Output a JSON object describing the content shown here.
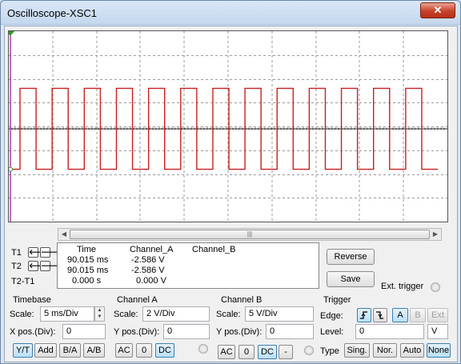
{
  "window": {
    "title": "Oscilloscope-XSC1",
    "close_label": "✕"
  },
  "display": {
    "background": "#ffffff",
    "grid_color": "#9a9a9a",
    "channel_a_color": "#cc1f1f",
    "trace_values": {
      "cycles": 13,
      "high_v": "3.4",
      "low_v": "-3.4",
      "baseline_v": "0"
    },
    "scroll_glyph": "|||"
  },
  "cursors": {
    "t1_label": "T1",
    "t2_label": "T2",
    "t2t1_label": "T2-T1",
    "headers": [
      "Time",
      "Channel_A",
      "Channel_B"
    ],
    "rows": [
      {
        "time": "90.015 ms",
        "a": "-2.586 V",
        "b": ""
      },
      {
        "time": "90.015 ms",
        "a": "-2.586 V",
        "b": ""
      },
      {
        "time": "0.000 s",
        "a": "0.000 V",
        "b": ""
      }
    ]
  },
  "actions": {
    "reverse": "Reverse",
    "save": "Save",
    "ext_trigger": "Ext. trigger"
  },
  "timebase": {
    "title": "Timebase",
    "scale_label": "Scale:",
    "scale_value": "5 ms/Div",
    "xpos_label": "X pos.(Div):",
    "xpos_value": "0",
    "modes": [
      "Y/T",
      "Add",
      "B/A",
      "A/B"
    ],
    "active_mode": "Y/T"
  },
  "channel_a": {
    "title": "Channel A",
    "scale_label": "Scale:",
    "scale_value": "2  V/Div",
    "ypos_label": "Y pos.(Div):",
    "ypos_value": "0",
    "coupling": [
      "AC",
      "0",
      "DC"
    ],
    "active": "DC"
  },
  "channel_b": {
    "title": "Channel B",
    "scale_label": "Scale:",
    "scale_value": "5  V/Div",
    "ypos_label": "Y pos.(Div):",
    "ypos_value": "0",
    "coupling": [
      "AC",
      "0",
      "DC",
      "-"
    ],
    "active": "DC"
  },
  "trigger": {
    "title": "Trigger",
    "edge_label": "Edge:",
    "sources": [
      "A",
      "B",
      "Ext"
    ],
    "active_source": "A",
    "level_label": "Level:",
    "level_value": "0",
    "level_unit": "V",
    "type_label": "Type",
    "types": [
      "Sing.",
      "Nor.",
      "Auto",
      "None"
    ],
    "active_type": "None"
  }
}
